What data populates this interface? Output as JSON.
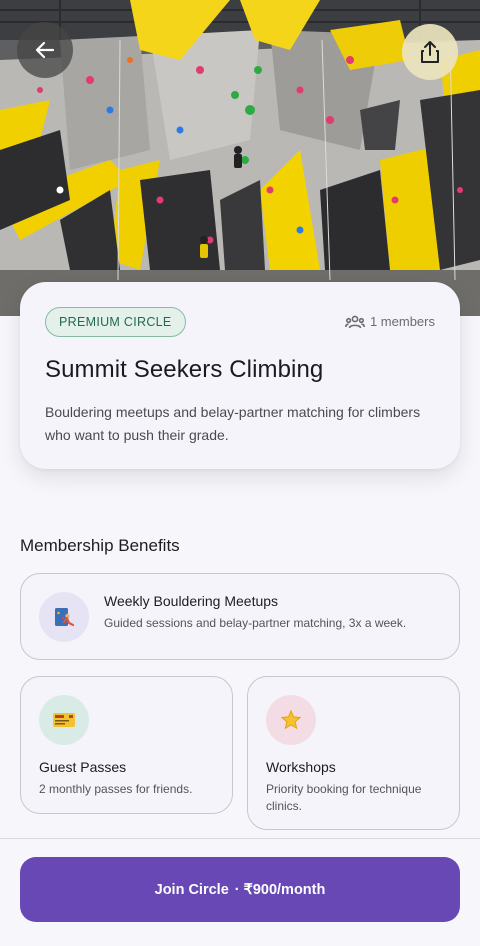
{
  "hero": {
    "back_icon": "arrow-left-icon",
    "share_icon": "share-icon"
  },
  "circle": {
    "badge": "PREMIUM CIRCLE",
    "members_text": "1 members",
    "members_icon": "people-icon",
    "title": "Summit Seekers Climbing",
    "description": "Bouldering meetups and belay-partner matching for climbers who want to push their grade."
  },
  "benefits": {
    "section_title": "Membership Benefits",
    "items": [
      {
        "icon": "climber-icon",
        "title": "Weekly Bouldering Meetups",
        "description": "Guided sessions and belay-partner matching, 3x a week.",
        "icon_bg": "#e6e3f5"
      },
      {
        "icon": "ticket-icon",
        "title": "Guest Passes",
        "description": "2 monthly passes for friends.",
        "icon_bg": "#d8ece5"
      },
      {
        "icon": "star-icon",
        "title": "Workshops",
        "description": "Priority booking for technique clinics.",
        "icon_bg": "#f4dce4"
      }
    ]
  },
  "cta": {
    "label": "Join Circle",
    "separator": "·",
    "price": "₹900/month",
    "color": "#6748b5"
  }
}
